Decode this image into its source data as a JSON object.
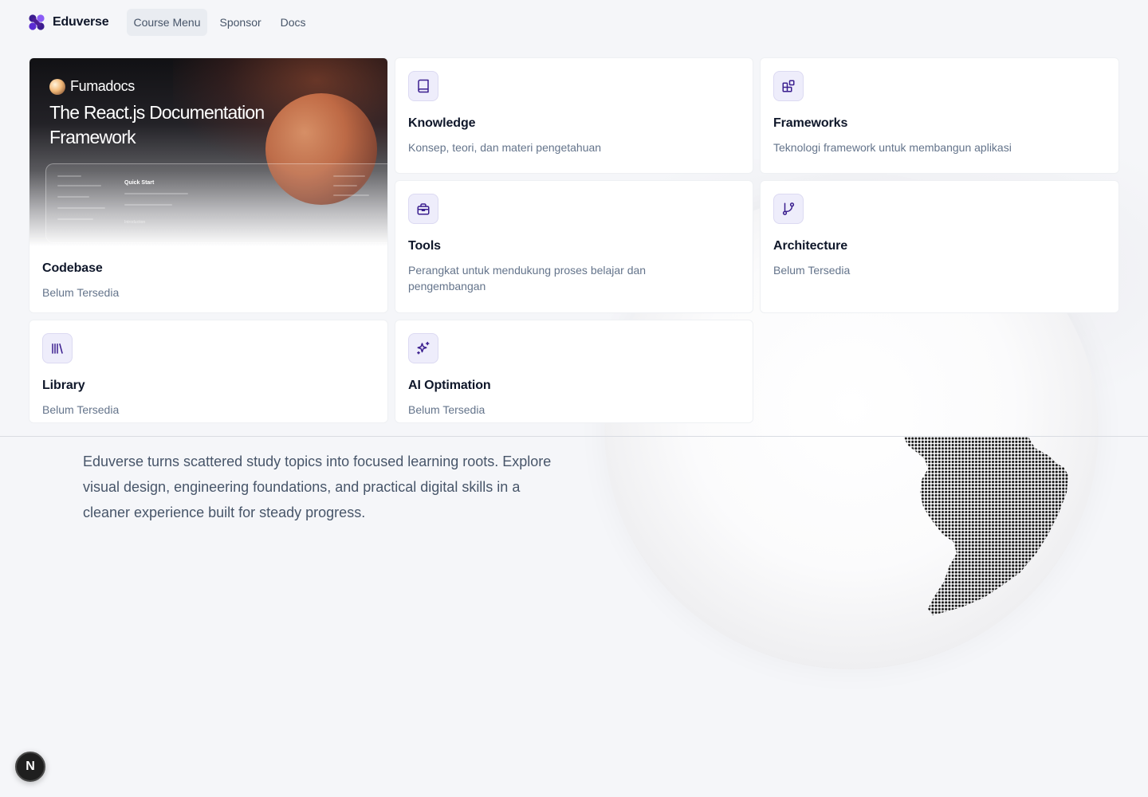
{
  "nav": {
    "brand": "Eduverse",
    "items": [
      {
        "label": "Course Menu",
        "active": true
      },
      {
        "label": "Sponsor",
        "active": false
      },
      {
        "label": "Docs",
        "active": false
      }
    ]
  },
  "hero_card": {
    "image_brand": "Fumadocs",
    "image_title": "The React.js Documentation Framework",
    "image_mock_heading": "Quick Start",
    "image_mock_intro": "Introduction",
    "title": "Codebase",
    "description": "Belum Tersedia"
  },
  "cards": [
    {
      "title": "Knowledge",
      "description": "Konsep, teori, dan materi pengetahuan",
      "icon": "book-icon"
    },
    {
      "title": "Frameworks",
      "description": "Teknologi framework untuk membangun aplikasi",
      "icon": "blocks-icon"
    },
    {
      "title": "Tools",
      "description": "Perangkat untuk mendukung proses belajar dan pengembangan",
      "icon": "toolbox-icon"
    },
    {
      "title": "Architecture",
      "description": "Belum Tersedia",
      "icon": "git-branch-icon"
    },
    {
      "title": "Library",
      "description": "Belum Tersedia",
      "icon": "library-icon"
    },
    {
      "title": "AI Optimation",
      "description": "Belum Tersedia",
      "icon": "sparkles-icon"
    }
  ],
  "intro_text": "Eduverse turns scattered study topics into focused learning roots. Explore visual design, engineering foundations, and practical digital skills in a cleaner experience built for steady progress.",
  "badge": "N",
  "colors": {
    "brand": "#4c1d95",
    "icon_accent": "#3b1f8f",
    "icon_bg": "#eeedfb",
    "background": "#f5f6f9"
  }
}
